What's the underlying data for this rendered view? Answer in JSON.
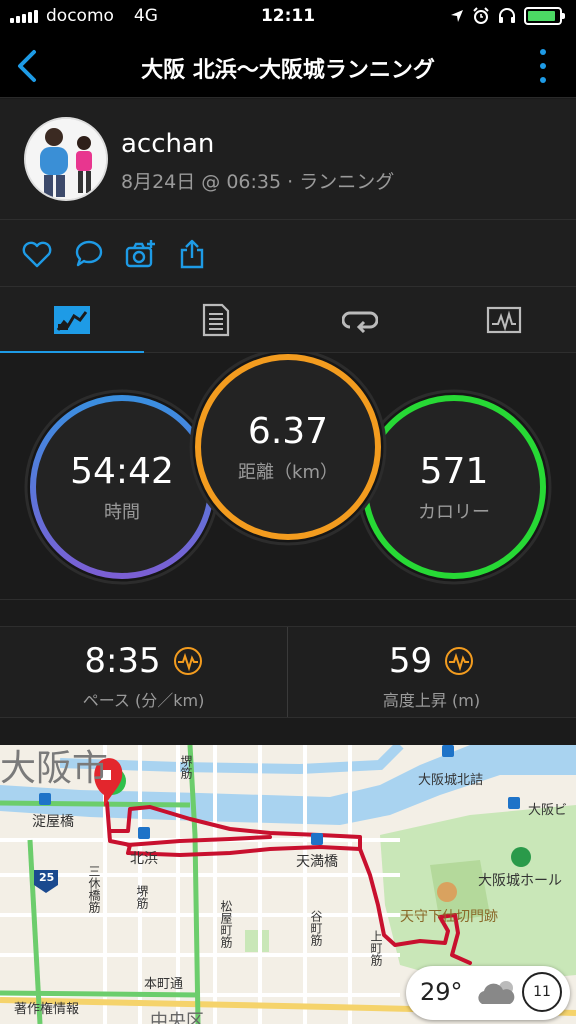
{
  "status_bar": {
    "carrier": "docomo",
    "network": "4G",
    "time": "12:11"
  },
  "nav": {
    "title": "大阪 北浜〜大阪城ランニング"
  },
  "profile": {
    "name": "acchan",
    "meta": "8月24日 @ 06:35 · ランニング"
  },
  "tabs": [
    {
      "icon": "overview-chart-icon",
      "active": true
    },
    {
      "icon": "details-list-icon",
      "active": false
    },
    {
      "icon": "laps-icon",
      "active": false
    },
    {
      "icon": "graph-icon",
      "active": false
    }
  ],
  "summary": {
    "time": {
      "value": "54:42",
      "label": "時間",
      "color": "#7b5fd4"
    },
    "distance": {
      "value": "6.37",
      "label": "距離（km）",
      "color": "#f39c1f"
    },
    "calories": {
      "value": "571",
      "label": "カロリー",
      "color": "#27d935"
    }
  },
  "stats": {
    "pace": {
      "value": "8:35",
      "label": "ペース (分／km)"
    },
    "ascent": {
      "value": "59",
      "label": "高度上昇 (m)"
    }
  },
  "map": {
    "labels": {
      "city": "大阪市",
      "yodoyabashi": "淀屋橋",
      "kitahama": "北浜",
      "tenmabashi": "天満橋",
      "osakajo_kitazume": "大阪城北詰",
      "osaka_bi": "大阪ビ",
      "osakajo_hall": "大阪城ホール",
      "tenshu": "天守下仕切門跡",
      "sakaisuji": "堺筋",
      "sankyobashi": "三休橋筋",
      "sakaisuji2": "堺筋",
      "matsuyamachi": "松屋町筋",
      "tanimachi": "谷町筋",
      "uemachi": "上町筋",
      "honmachi": "本町通",
      "route25": "25",
      "chosakuken": "著作権情報",
      "chuo": "中央区"
    },
    "weather": {
      "temp": "29°",
      "aqi": "11"
    },
    "colors": {
      "route": "#c8102e",
      "water": "#a9d3f0",
      "park": "#c9e7b8",
      "road_major": "#6ccd6c"
    }
  }
}
